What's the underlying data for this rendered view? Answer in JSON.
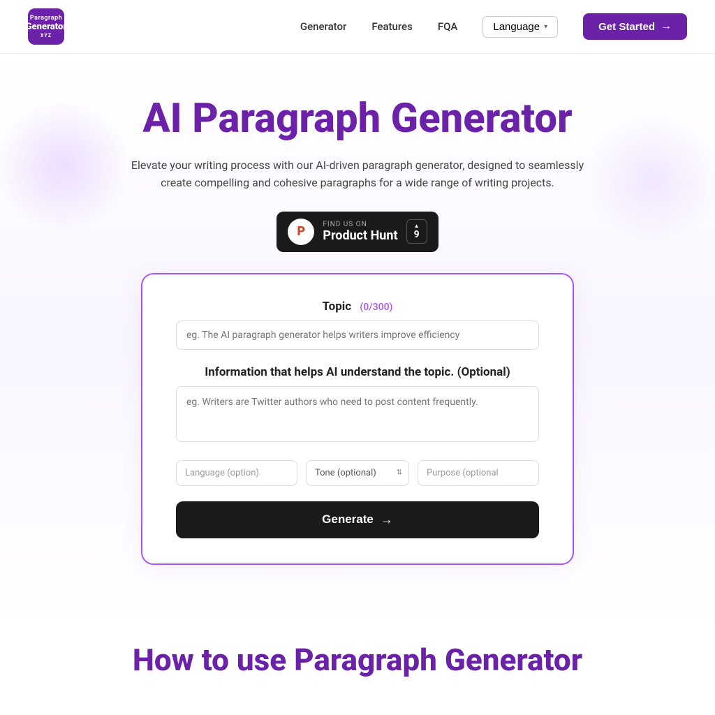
{
  "nav": {
    "logo_line1": "Paragraph",
    "logo_line2": "Generator",
    "logo_line3": "XYZ",
    "links": [
      {
        "id": "generator",
        "label": "Generator"
      },
      {
        "id": "features",
        "label": "Features"
      },
      {
        "id": "fqa",
        "label": "FQA"
      }
    ],
    "language_label": "Language",
    "get_started_label": "Get Started"
  },
  "hero": {
    "title": "AI Paragraph Generator",
    "subtitle": "Elevate your writing process with our AI-driven paragraph generator, designed to seamlessly create compelling and cohesive paragraphs for a wide range of writing projects.",
    "ph_find_text": "FIND US ON",
    "ph_name": "Product Hunt",
    "ph_votes": "9"
  },
  "form": {
    "topic_label": "Topic",
    "topic_char_count": "(0/300)",
    "topic_placeholder": "eg. The AI paragraph generator helps writers improve efficiency",
    "info_label": "Information that helps AI understand the topic. (Optional)",
    "info_placeholder": "eg. Writers are Twitter authors who need to post content frequently.",
    "language_placeholder": "Language (option)",
    "tone_placeholder": "Tone (optional)",
    "purpose_placeholder": "Purpose (optional",
    "generate_label": "Generate"
  },
  "bottom": {
    "how_to_title": "How to use Paragraph Generator"
  },
  "colors": {
    "purple": "#6b21a8",
    "dark": "#1a1a1a",
    "border_purple": "#a855f7"
  }
}
